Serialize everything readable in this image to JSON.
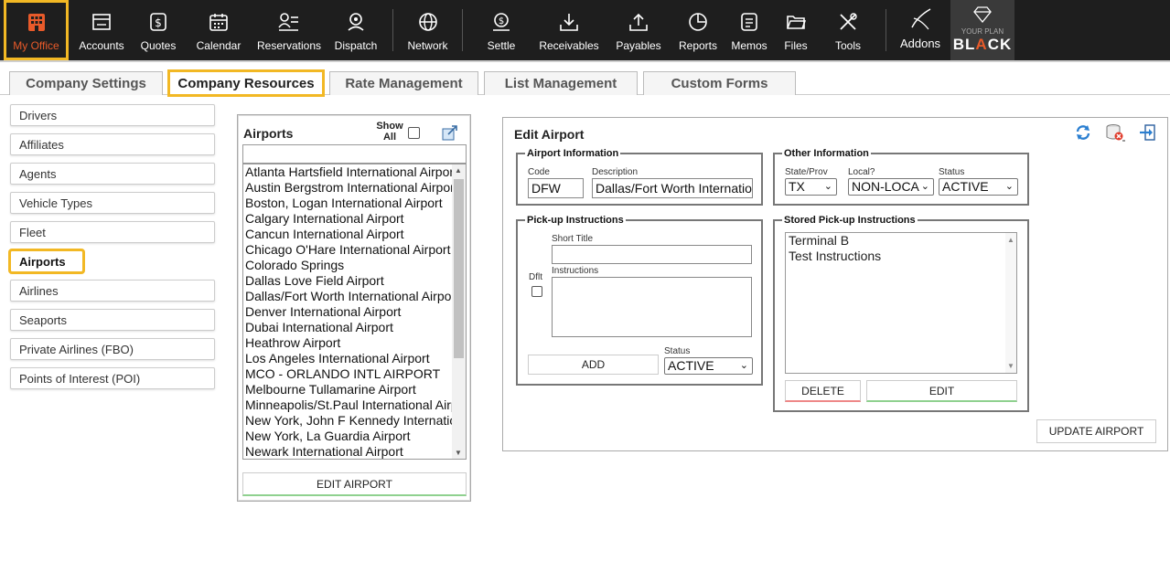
{
  "nav": {
    "items": [
      {
        "label": "My Office",
        "icon": "building-icon"
      },
      {
        "label": "Accounts",
        "icon": "window-icon"
      },
      {
        "label": "Quotes",
        "icon": "dollar-icon"
      },
      {
        "label": "Calendar",
        "icon": "calendar-icon"
      },
      {
        "label": "Reservations",
        "icon": "person-list-icon"
      },
      {
        "label": "Dispatch",
        "icon": "pin-icon"
      },
      {
        "label": "Network",
        "icon": "globe-icon"
      },
      {
        "label": "Settle",
        "icon": "money-icon"
      },
      {
        "label": "Receivables",
        "icon": "download-icon"
      },
      {
        "label": "Payables",
        "icon": "upload-icon"
      },
      {
        "label": "Reports",
        "icon": "pie-icon"
      },
      {
        "label": "Memos",
        "icon": "memo-icon"
      },
      {
        "label": "Files",
        "icon": "folder-icon"
      },
      {
        "label": "Tools",
        "icon": "tools-icon"
      },
      {
        "label": "Addons",
        "icon": "addons-icon"
      }
    ],
    "plan": {
      "small": "YOUR PLAN",
      "big_a": "BL",
      "big_accent": "A",
      "big_b": "CK"
    }
  },
  "tabs": [
    "Company Settings",
    "Company Resources",
    "Rate Management",
    "List Management",
    "Custom Forms"
  ],
  "side": [
    "Drivers",
    "Affiliates",
    "Agents",
    "Vehicle Types",
    "Fleet",
    "Airports",
    "Airlines",
    "Seaports",
    "Private Airlines (FBO)",
    "Points of Interest (POI)"
  ],
  "airports": {
    "title": "Airports",
    "show_all": "Show All",
    "list": [
      "Atlanta Hartsfield International Airport",
      "Austin Bergstrom International Airport",
      "Boston, Logan International Airport",
      "Calgary International Airport",
      "Cancun International Airport",
      "Chicago O'Hare International Airport A",
      "Colorado Springs",
      "Dallas Love Field Airport",
      "Dallas/Fort Worth International Airport",
      "Denver International Airport",
      "Dubai International Airport",
      "Heathrow Airport",
      "Los Angeles International Airport",
      "MCO - ORLANDO INTL AIRPORT",
      "Melbourne Tullamarine Airport",
      "Minneapolis/St.Paul International Airpo",
      "New York, John F Kennedy Internation",
      "New York, La Guardia Airport",
      "Newark International Airport"
    ],
    "edit_button": "EDIT AIRPORT"
  },
  "edit": {
    "title": "Edit Airport",
    "airport_info": {
      "legend": "Airport Information",
      "code_label": "Code",
      "code": "DFW",
      "desc_label": "Description",
      "desc": "Dallas/Fort Worth Internatior"
    },
    "other_info": {
      "legend": "Other Information",
      "state_label": "State/Prov",
      "state": "TX",
      "local_label": "Local?",
      "local": "NON-LOCA",
      "status_label": "Status",
      "status": "ACTIVE"
    },
    "pickup": {
      "legend": "Pick-up Instructions",
      "short_title_label": "Short Title",
      "instructions_label": "Instructions",
      "dflt_label": "Dflt",
      "add_button": "ADD",
      "status_label": "Status",
      "status": "ACTIVE"
    },
    "stored": {
      "legend": "Stored Pick-up Instructions",
      "items": [
        "Terminal B",
        "Test Instructions"
      ],
      "delete_button": "DELETE",
      "edit_button": "EDIT"
    },
    "update_button": "UPDATE AIRPORT"
  }
}
